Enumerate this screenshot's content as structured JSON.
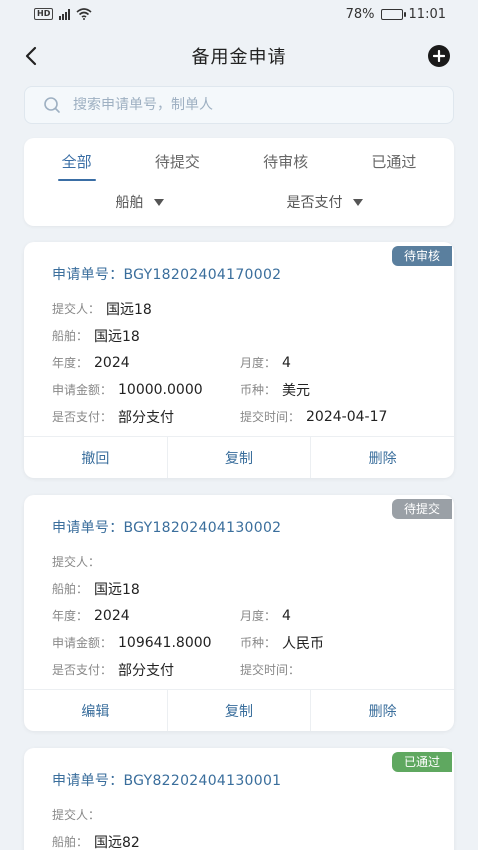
{
  "status_bar": {
    "network": "HD",
    "signal_label": "4G",
    "battery_text": "78%",
    "battery_level": 0.78,
    "time": "11:01"
  },
  "header": {
    "title": "备用金申请"
  },
  "search": {
    "placeholder": "搜索申请单号，制单人",
    "value": ""
  },
  "tabs": [
    {
      "label": "全部",
      "active": true
    },
    {
      "label": "待提交",
      "active": false
    },
    {
      "label": "待审核",
      "active": false
    },
    {
      "label": "已通过",
      "active": false
    }
  ],
  "filters": {
    "ship_label": "船舶",
    "paid_label": "是否支付"
  },
  "cards": [
    {
      "status": "待审核",
      "order_label": "申请单号：",
      "order_no": "BGY18202404170002",
      "submitter_label": "提交人：",
      "submitter": "国远18",
      "ship_label": "船舶：",
      "ship": "国远18",
      "year_label": "年度：",
      "year": "2024",
      "month_label": "月度：",
      "month": "4",
      "amount_label": "申请金额：",
      "amount": "10000.0000",
      "currency_label": "币种：",
      "currency": "美元",
      "paid_label": "是否支付：",
      "paid": "部分支付",
      "submit_time_label": "提交时间：",
      "submit_time": "2024-04-17",
      "actions": [
        "撤回",
        "复制",
        "删除"
      ]
    },
    {
      "status": "待提交",
      "order_label": "申请单号：",
      "order_no": "BGY18202404130002",
      "submitter_label": "提交人：",
      "submitter": "",
      "ship_label": "船舶：",
      "ship": "国远18",
      "year_label": "年度：",
      "year": "2024",
      "month_label": "月度：",
      "month": "4",
      "amount_label": "申请金额：",
      "amount": "109641.8000",
      "currency_label": "币种：",
      "currency": "人民币",
      "paid_label": "是否支付：",
      "paid": "部分支付",
      "submit_time_label": "提交时间：",
      "submit_time": "",
      "actions": [
        "编辑",
        "复制",
        "删除"
      ]
    },
    {
      "status": "已通过",
      "order_label": "申请单号：",
      "order_no": "BGY82202404130001",
      "submitter_label": "提交人：",
      "submitter": "",
      "ship_label": "船舶：",
      "ship": "国远82"
    }
  ],
  "colors": {
    "accent": "#3a6ea5",
    "tag_review": "#5a7f9e",
    "tag_pending": "#9aa0a6",
    "tag_approved": "#5fa860",
    "background": "#eef2f6"
  }
}
